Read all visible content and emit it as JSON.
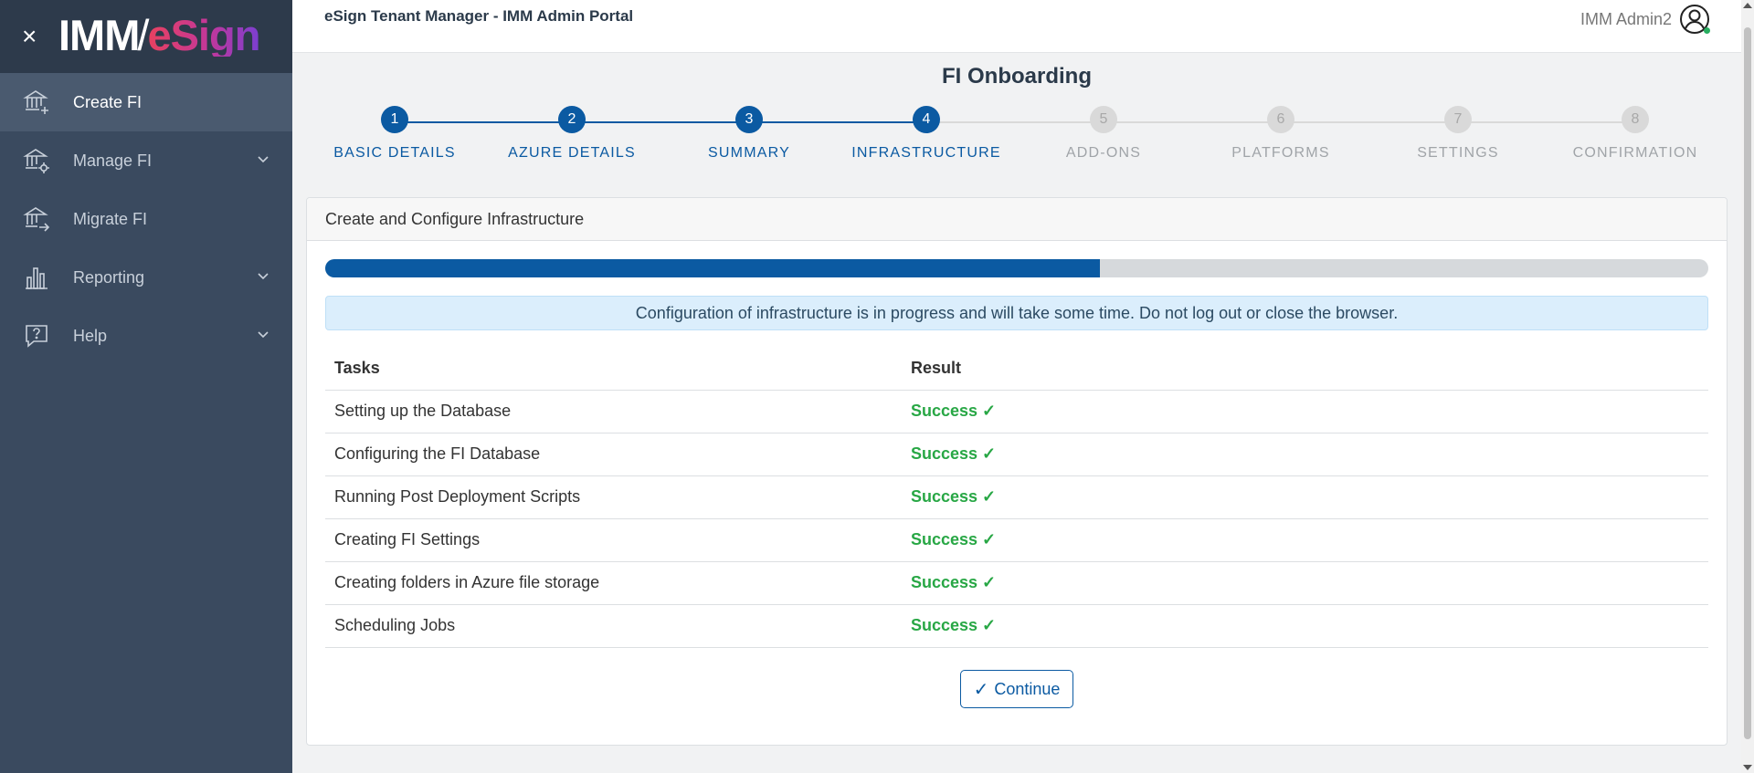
{
  "sidebar": {
    "close_glyph": "×",
    "logo": {
      "left": "IMM",
      "slash": "/",
      "right": "eSign"
    },
    "items": [
      {
        "label": "Create FI",
        "icon": "bank-plus-icon",
        "active": true,
        "expandable": false
      },
      {
        "label": "Manage FI",
        "icon": "bank-gear-icon",
        "active": false,
        "expandable": true
      },
      {
        "label": "Migrate FI",
        "icon": "bank-arrow-icon",
        "active": false,
        "expandable": false
      },
      {
        "label": "Reporting",
        "icon": "bar-chart-icon",
        "active": false,
        "expandable": true
      },
      {
        "label": "Help",
        "icon": "help-bubble-icon",
        "active": false,
        "expandable": true
      }
    ]
  },
  "header": {
    "title": "eSign Tenant Manager - IMM Admin Portal",
    "user_name": "IMM Admin2",
    "user_icon": "user-circle-icon",
    "online_color": "#27ae60"
  },
  "page": {
    "title": "FI Onboarding"
  },
  "stepper": {
    "steps": [
      {
        "number": "1",
        "label": "BASIC DETAILS",
        "status": "done"
      },
      {
        "number": "2",
        "label": "AZURE DETAILS",
        "status": "done"
      },
      {
        "number": "3",
        "label": "SUMMARY",
        "status": "done"
      },
      {
        "number": "4",
        "label": "INFRASTRUCTURE",
        "status": "done"
      },
      {
        "number": "5",
        "label": "ADD-ONS",
        "status": "todo"
      },
      {
        "number": "6",
        "label": "PLATFORMS",
        "status": "todo"
      },
      {
        "number": "7",
        "label": "SETTINGS",
        "status": "todo"
      },
      {
        "number": "8",
        "label": "CONFIRMATION",
        "status": "todo"
      }
    ],
    "active_color": "#0b5aa2",
    "inactive_color": "#d9d9d9"
  },
  "card": {
    "title": "Create and Configure Infrastructure",
    "progress_percent": 56,
    "alert": "Configuration of infrastructure is in progress and will take some time. Do not log out or close the browser.",
    "table": {
      "headers": {
        "tasks": "Tasks",
        "result": "Result"
      },
      "rows": [
        {
          "task": "Setting up the Database",
          "result": "Success ✓"
        },
        {
          "task": "Configuring the FI Database",
          "result": "Success ✓"
        },
        {
          "task": "Running Post Deployment Scripts",
          "result": "Success ✓"
        },
        {
          "task": "Creating FI Settings",
          "result": "Success ✓"
        },
        {
          "task": "Creating folders in Azure file storage",
          "result": "Success ✓"
        },
        {
          "task": "Scheduling Jobs",
          "result": "Success ✓"
        }
      ],
      "success_color": "#28a745"
    },
    "continue_button": {
      "label": "Continue",
      "icon": "check-icon",
      "glyph": "✓"
    }
  }
}
